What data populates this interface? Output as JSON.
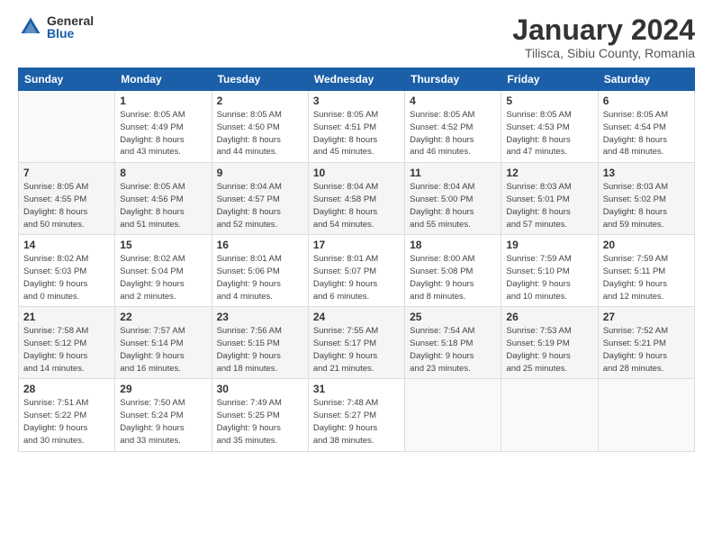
{
  "logo": {
    "general": "General",
    "blue": "Blue"
  },
  "title": "January 2024",
  "subtitle": "Tilisca, Sibiu County, Romania",
  "headers": [
    "Sunday",
    "Monday",
    "Tuesday",
    "Wednesday",
    "Thursday",
    "Friday",
    "Saturday"
  ],
  "weeks": [
    [
      {
        "day": "",
        "info": ""
      },
      {
        "day": "1",
        "info": "Sunrise: 8:05 AM\nSunset: 4:49 PM\nDaylight: 8 hours\nand 43 minutes."
      },
      {
        "day": "2",
        "info": "Sunrise: 8:05 AM\nSunset: 4:50 PM\nDaylight: 8 hours\nand 44 minutes."
      },
      {
        "day": "3",
        "info": "Sunrise: 8:05 AM\nSunset: 4:51 PM\nDaylight: 8 hours\nand 45 minutes."
      },
      {
        "day": "4",
        "info": "Sunrise: 8:05 AM\nSunset: 4:52 PM\nDaylight: 8 hours\nand 46 minutes."
      },
      {
        "day": "5",
        "info": "Sunrise: 8:05 AM\nSunset: 4:53 PM\nDaylight: 8 hours\nand 47 minutes."
      },
      {
        "day": "6",
        "info": "Sunrise: 8:05 AM\nSunset: 4:54 PM\nDaylight: 8 hours\nand 48 minutes."
      }
    ],
    [
      {
        "day": "7",
        "info": "Sunrise: 8:05 AM\nSunset: 4:55 PM\nDaylight: 8 hours\nand 50 minutes."
      },
      {
        "day": "8",
        "info": "Sunrise: 8:05 AM\nSunset: 4:56 PM\nDaylight: 8 hours\nand 51 minutes."
      },
      {
        "day": "9",
        "info": "Sunrise: 8:04 AM\nSunset: 4:57 PM\nDaylight: 8 hours\nand 52 minutes."
      },
      {
        "day": "10",
        "info": "Sunrise: 8:04 AM\nSunset: 4:58 PM\nDaylight: 8 hours\nand 54 minutes."
      },
      {
        "day": "11",
        "info": "Sunrise: 8:04 AM\nSunset: 5:00 PM\nDaylight: 8 hours\nand 55 minutes."
      },
      {
        "day": "12",
        "info": "Sunrise: 8:03 AM\nSunset: 5:01 PM\nDaylight: 8 hours\nand 57 minutes."
      },
      {
        "day": "13",
        "info": "Sunrise: 8:03 AM\nSunset: 5:02 PM\nDaylight: 8 hours\nand 59 minutes."
      }
    ],
    [
      {
        "day": "14",
        "info": "Sunrise: 8:02 AM\nSunset: 5:03 PM\nDaylight: 9 hours\nand 0 minutes."
      },
      {
        "day": "15",
        "info": "Sunrise: 8:02 AM\nSunset: 5:04 PM\nDaylight: 9 hours\nand 2 minutes."
      },
      {
        "day": "16",
        "info": "Sunrise: 8:01 AM\nSunset: 5:06 PM\nDaylight: 9 hours\nand 4 minutes."
      },
      {
        "day": "17",
        "info": "Sunrise: 8:01 AM\nSunset: 5:07 PM\nDaylight: 9 hours\nand 6 minutes."
      },
      {
        "day": "18",
        "info": "Sunrise: 8:00 AM\nSunset: 5:08 PM\nDaylight: 9 hours\nand 8 minutes."
      },
      {
        "day": "19",
        "info": "Sunrise: 7:59 AM\nSunset: 5:10 PM\nDaylight: 9 hours\nand 10 minutes."
      },
      {
        "day": "20",
        "info": "Sunrise: 7:59 AM\nSunset: 5:11 PM\nDaylight: 9 hours\nand 12 minutes."
      }
    ],
    [
      {
        "day": "21",
        "info": "Sunrise: 7:58 AM\nSunset: 5:12 PM\nDaylight: 9 hours\nand 14 minutes."
      },
      {
        "day": "22",
        "info": "Sunrise: 7:57 AM\nSunset: 5:14 PM\nDaylight: 9 hours\nand 16 minutes."
      },
      {
        "day": "23",
        "info": "Sunrise: 7:56 AM\nSunset: 5:15 PM\nDaylight: 9 hours\nand 18 minutes."
      },
      {
        "day": "24",
        "info": "Sunrise: 7:55 AM\nSunset: 5:17 PM\nDaylight: 9 hours\nand 21 minutes."
      },
      {
        "day": "25",
        "info": "Sunrise: 7:54 AM\nSunset: 5:18 PM\nDaylight: 9 hours\nand 23 minutes."
      },
      {
        "day": "26",
        "info": "Sunrise: 7:53 AM\nSunset: 5:19 PM\nDaylight: 9 hours\nand 25 minutes."
      },
      {
        "day": "27",
        "info": "Sunrise: 7:52 AM\nSunset: 5:21 PM\nDaylight: 9 hours\nand 28 minutes."
      }
    ],
    [
      {
        "day": "28",
        "info": "Sunrise: 7:51 AM\nSunset: 5:22 PM\nDaylight: 9 hours\nand 30 minutes."
      },
      {
        "day": "29",
        "info": "Sunrise: 7:50 AM\nSunset: 5:24 PM\nDaylight: 9 hours\nand 33 minutes."
      },
      {
        "day": "30",
        "info": "Sunrise: 7:49 AM\nSunset: 5:25 PM\nDaylight: 9 hours\nand 35 minutes."
      },
      {
        "day": "31",
        "info": "Sunrise: 7:48 AM\nSunset: 5:27 PM\nDaylight: 9 hours\nand 38 minutes."
      },
      {
        "day": "",
        "info": ""
      },
      {
        "day": "",
        "info": ""
      },
      {
        "day": "",
        "info": ""
      }
    ]
  ]
}
